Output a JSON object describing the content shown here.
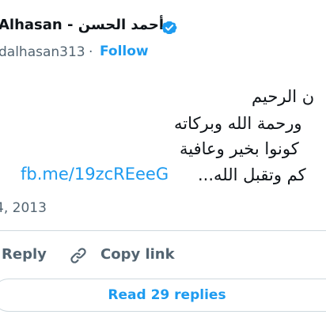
{
  "author": {
    "display_name": "Alhasan - أحمد الحسن",
    "handle": "dalhasan313",
    "separator": "·",
    "follow_label": "Follow",
    "verified_icon": "verified-badge-icon",
    "verified_color": "#1d9bf0"
  },
  "tweet": {
    "lines": [
      "ن الرحيم",
      "ورحمة الله وبركاته",
      "كونوا بخير وعافية",
      "كم وتقبل الله..."
    ],
    "link_text": "fb.me/19zcREeeG",
    "date": "4, 2013"
  },
  "actions": {
    "reply_label": "Reply",
    "copy_link_label": "Copy link",
    "copy_link_icon": "link-icon"
  },
  "replies": {
    "read_label": "Read 29 replies"
  },
  "colors": {
    "accent": "#1d9bf0",
    "text": "#0f1419",
    "muted": "#536471",
    "border": "#cfd9de"
  }
}
